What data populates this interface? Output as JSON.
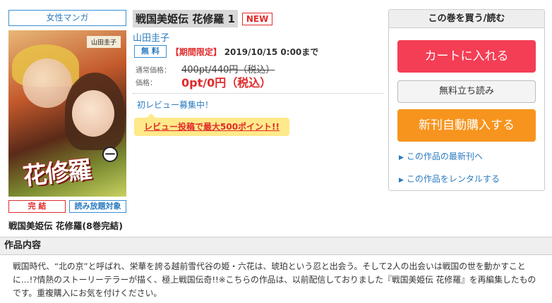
{
  "genre": "女性マンガ",
  "cover": {
    "author_strip": "山田圭子",
    "title_art": "花修羅",
    "volume_mark": "一"
  },
  "tags": {
    "completed": "完 結",
    "unlimited": "読み放題対象"
  },
  "series_title": "戦国美姫伝 花修羅(8巻完結)",
  "book": {
    "title": "戦国美姫伝 花修羅 1",
    "new_badge": "NEW",
    "author": "山田圭子",
    "free_badge": "無 料",
    "period_label": "【期間限定】",
    "period_date": "2019/10/15 0:00まで",
    "regular_price_label": "通常価格：",
    "regular_price": "400pt/440円（税込）",
    "price_label": "価格：",
    "price": "0pt/0円（税込）"
  },
  "review": {
    "link": "初レビュー募集中！",
    "banner": "レビュー投稿で最大500ポイント!!"
  },
  "buy_panel": {
    "heading": "この巻を買う/読む",
    "cart_button": "カートに入れる",
    "trial_button": "無料立ち読み",
    "auto_button": "新刊自動購入する",
    "link_latest": "この作品の最新刊へ",
    "link_rental": "この作品をレンタルする"
  },
  "description": {
    "heading": "作品内容",
    "body": "戦国時代、“北の京”と呼ばれ、栄華を誇る越前雪代谷の姫・六花は、琥珀という忍と出会う。そして2人の出会いは戦国の世を動かすことに…!?情熱のストーリーテラーが描く、極上戦国伝奇!!※こちらの作品は、以前配信しておりました『戦国美姫伝 花修羅』を再編集したものです。重複購入にお気を付けください。"
  },
  "colors": {
    "accent_blue": "#2a7bc0",
    "accent_red": "#e02b2b",
    "cart_button": "#f43e55",
    "auto_button": "#f7941d",
    "review_banner": "#ffe98a"
  }
}
